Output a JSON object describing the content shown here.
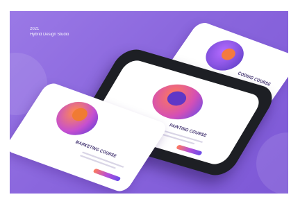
{
  "header": {
    "year": "2021",
    "studio": "Hybrid Design Studio"
  },
  "screens": {
    "left_title": "MARKETING COURSE",
    "center_title": "PAINTING COURSE",
    "right_title": "CODING COURSE"
  },
  "colors": {
    "background": "#8a66dd",
    "accent_orange": "#ff7a59",
    "accent_purple": "#6a4de8"
  }
}
